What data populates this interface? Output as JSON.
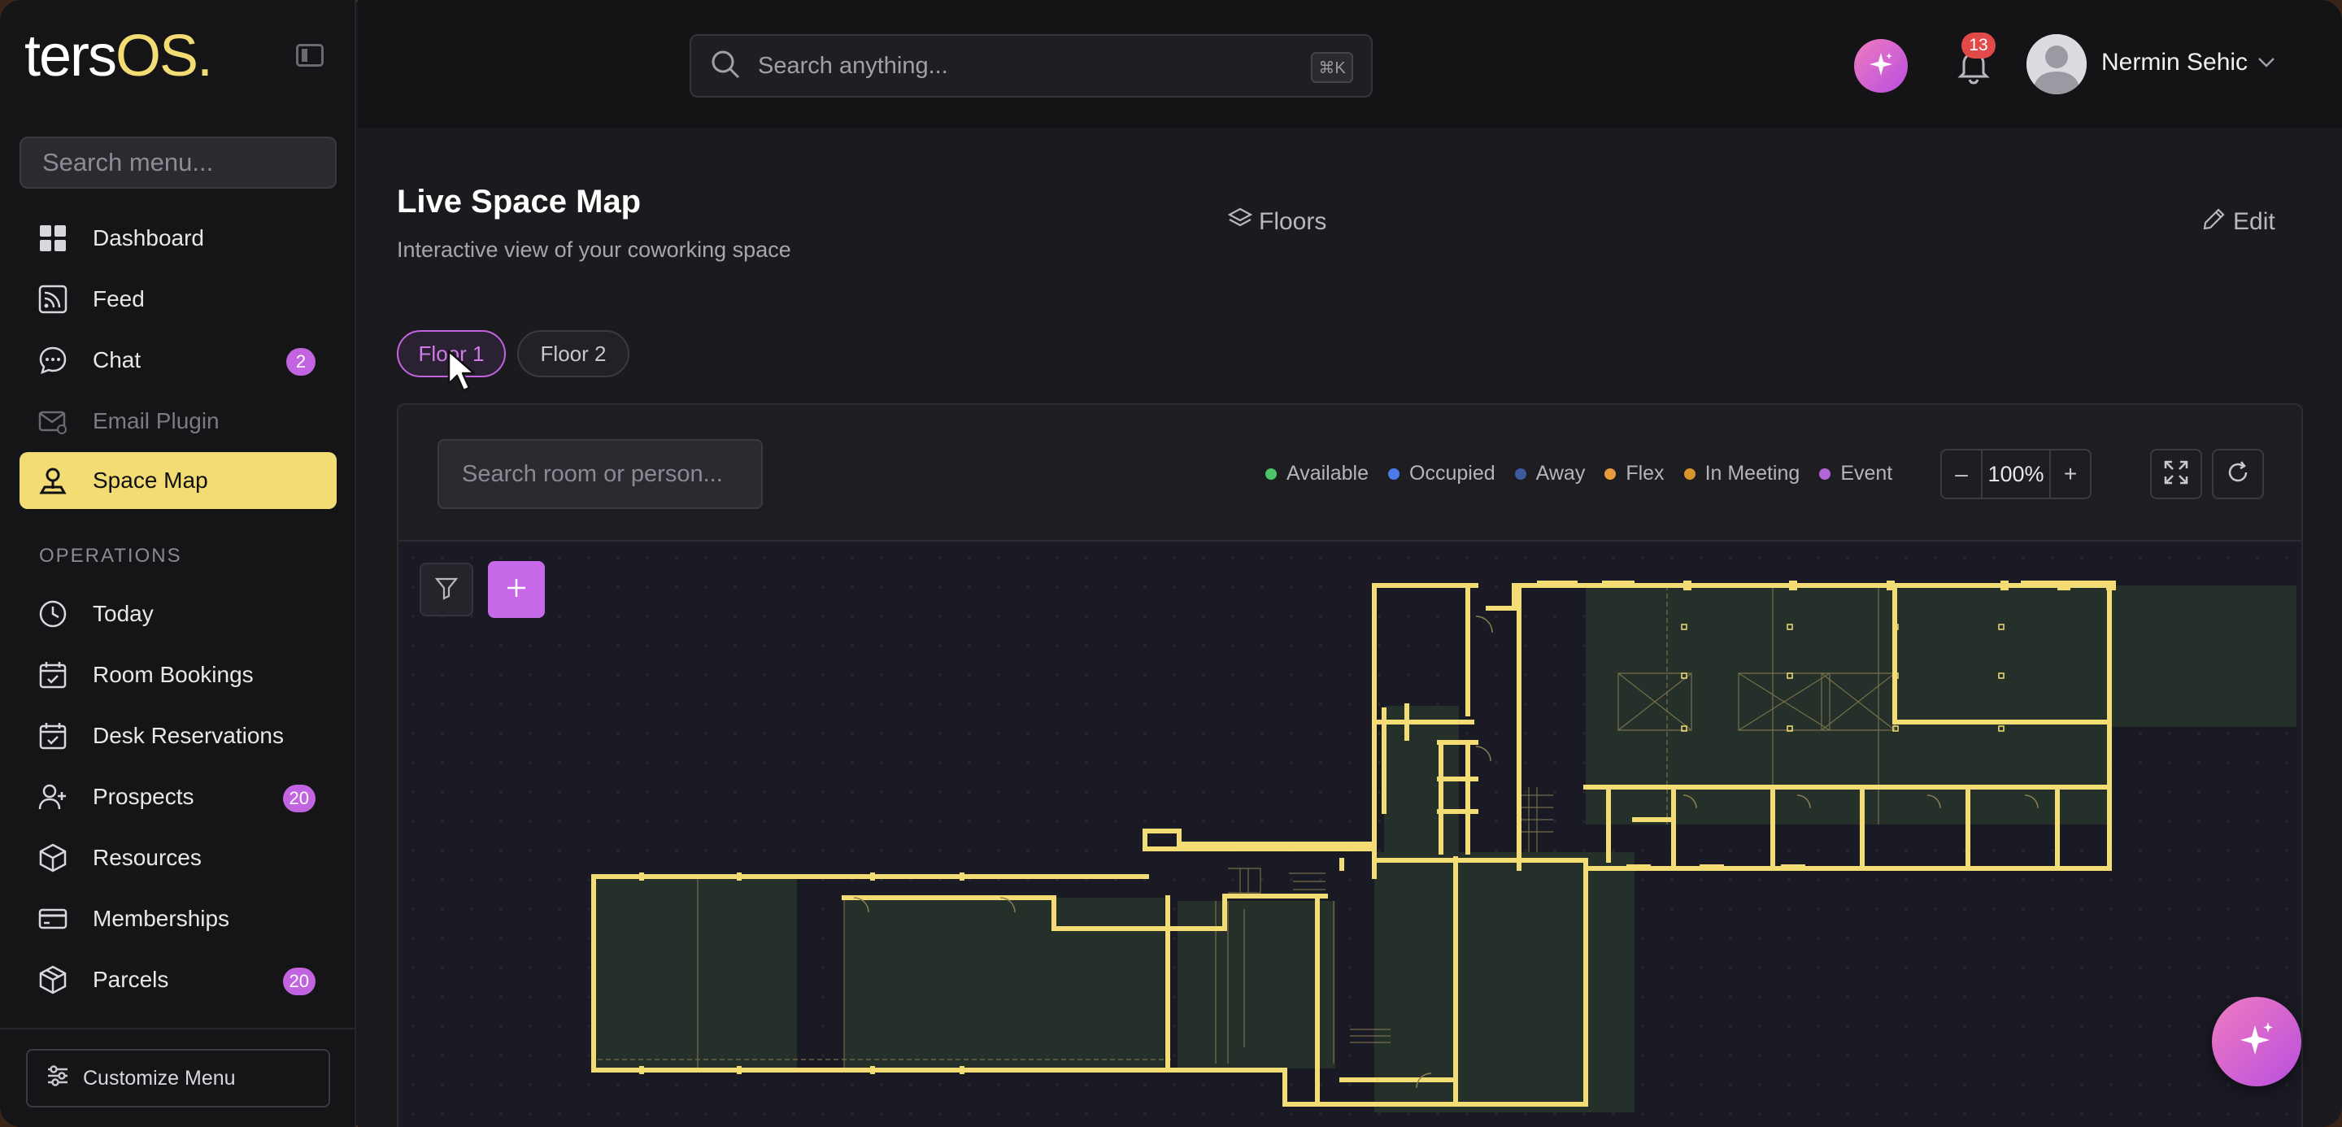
{
  "app": {
    "logo_main": "ters",
    "logo_accent": "OS."
  },
  "sidebar": {
    "search_placeholder": "Search menu...",
    "items": [
      {
        "label": "Dashboard",
        "icon": "grid-icon"
      },
      {
        "label": "Feed",
        "icon": "rss-icon"
      },
      {
        "label": "Chat",
        "icon": "chat-icon",
        "badge": "2"
      },
      {
        "label": "Email Plugin",
        "icon": "email-icon",
        "disabled": true
      },
      {
        "label": "Space Map",
        "icon": "map-pin-icon",
        "active": true
      }
    ],
    "section_label": "OPERATIONS",
    "ops_items": [
      {
        "label": "Today",
        "icon": "clock-icon"
      },
      {
        "label": "Room Bookings",
        "icon": "calendar-check-icon"
      },
      {
        "label": "Desk Reservations",
        "icon": "calendar-check-icon"
      },
      {
        "label": "Prospects",
        "icon": "user-plus-icon",
        "badge": "20"
      },
      {
        "label": "Resources",
        "icon": "box-icon"
      },
      {
        "label": "Memberships",
        "icon": "card-icon"
      },
      {
        "label": "Parcels",
        "icon": "package-icon",
        "badge": "20"
      }
    ],
    "customize_label": "Customize Menu"
  },
  "header": {
    "search_placeholder": "Search anything...",
    "search_shortcut": "⌘K",
    "notifications_count": "13",
    "user_name": "Nermin Sehic"
  },
  "page": {
    "title": "Live Space Map",
    "subtitle": "Interactive view of your coworking space",
    "floors_button": "Floors",
    "edit_button": "Edit",
    "floor_tabs": [
      "Floor 1",
      "Floor 2"
    ],
    "active_floor": "Floor 1"
  },
  "map": {
    "search_placeholder": "Search room or person...",
    "legend": [
      {
        "label": "Available",
        "color": "#4cc46a"
      },
      {
        "label": "Occupied",
        "color": "#4f7be8"
      },
      {
        "label": "Away",
        "color": "#3d5a9e"
      },
      {
        "label": "Flex",
        "color": "#e89a3c"
      },
      {
        "label": "In Meeting",
        "color": "#d8952e"
      },
      {
        "label": "Event",
        "color": "#b265d8"
      }
    ],
    "zoom_minus": "–",
    "zoom_level": "100%",
    "zoom_plus": "+"
  },
  "colors": {
    "accent_yellow": "#f3dc74",
    "accent_purple": "#c264e0",
    "wall": "#f3dc74",
    "room_fill": "#25302b"
  }
}
